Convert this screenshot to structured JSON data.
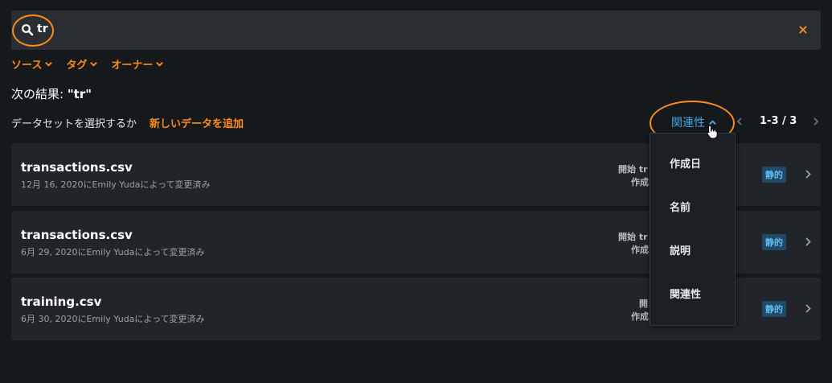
{
  "search": {
    "value": "tr",
    "clear_label": "×"
  },
  "filters": [
    {
      "label": "ソース"
    },
    {
      "label": "タグ"
    },
    {
      "label": "オーナー"
    }
  ],
  "results": {
    "prefix": "次の結果: ",
    "query": "\"tr\""
  },
  "select_row": {
    "prompt": "データセットを選択するか",
    "add_new": "新しいデータを追加"
  },
  "sort": {
    "current": "関連性",
    "options": [
      "作成日",
      "名前",
      "説明",
      "関連性"
    ]
  },
  "pager": {
    "text": "1-3 / 3"
  },
  "items": [
    {
      "name": "transactions.csv",
      "meta": "12月 16, 2020にEmily Yudaによって変更済み",
      "right1": "開始 tr",
      "right2": "作成",
      "badge": "静的"
    },
    {
      "name": "transactions.csv",
      "meta": "6月 29, 2020にEmily Yudaによって変更済み",
      "right1": "開始 tr",
      "right2": "作成",
      "badge": "静的"
    },
    {
      "name": "training.csv",
      "meta": "6月 30, 2020にEmily Yudaによって変更済み",
      "right1": "開",
      "right2": "作成",
      "badge": "静的"
    }
  ],
  "colors": {
    "accent": "#ff8c1a",
    "link": "#43a5e6",
    "badge_bg": "#214a66",
    "badge_text": "#62b8f0"
  },
  "icons": {
    "search": "search-icon",
    "clear": "close-icon",
    "chevron_down": "chevron-down-icon",
    "chevron_up": "chevron-up-icon",
    "chevron_left": "chevron-left-icon",
    "chevron_right": "chevron-right-icon",
    "cursor": "hand-cursor-icon"
  }
}
